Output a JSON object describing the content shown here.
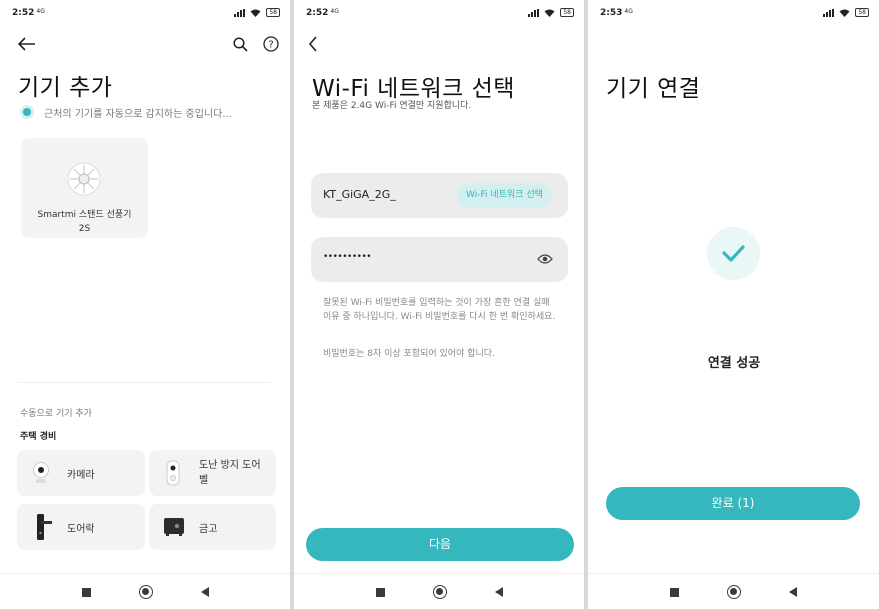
{
  "status": [
    {
      "time": "2:52",
      "net": "4G",
      "battery": "58"
    },
    {
      "time": "2:52",
      "net": "4G",
      "battery": "58"
    },
    {
      "time": "2:53",
      "net": "4G",
      "battery": "58"
    }
  ],
  "screen1": {
    "title": "기기 추가",
    "scanning_text": "근처의 기기를 자동으로 감지하는 중입니다...",
    "found_device": {
      "name": "Smartmi 스탠드 선풍기 2S"
    },
    "manual_label": "수동으로 기기 추가",
    "category": "주택 경비",
    "devices": [
      {
        "label": "카메라",
        "icon": "camera-icon"
      },
      {
        "label": "도난 방지 도어벨",
        "icon": "doorbell-icon"
      },
      {
        "label": "도어락",
        "icon": "door-lock-icon"
      },
      {
        "label": "금고",
        "icon": "safe-icon"
      }
    ]
  },
  "screen2": {
    "title": "Wi-Fi 네트워크 선택",
    "subtitle": "본 제품은 2.4G Wi-Fi 연결만 지원합니다.",
    "ssid": "KT_GiGA_2G_",
    "select_network_label": "Wi-Fi 네트워크 선택",
    "password_masked": "••••••••••",
    "hint1": "잘못된 Wi-Fi 비밀번호를 입력하는 것이 가장 흔한 연결 실패 이유 중 하나입니다. Wi-Fi 비밀번호를 다시 한 번 확인하세요.",
    "hint2": "비밀번호는 8자 이상 포함되어 있어야 합니다.",
    "next_label": "다음"
  },
  "screen3": {
    "title": "기기 연결",
    "success_text": "연결 성공",
    "done_label": "완료 (1)"
  },
  "colors": {
    "accent": "#35b8bd",
    "success_bg": "#eaf7f7"
  }
}
